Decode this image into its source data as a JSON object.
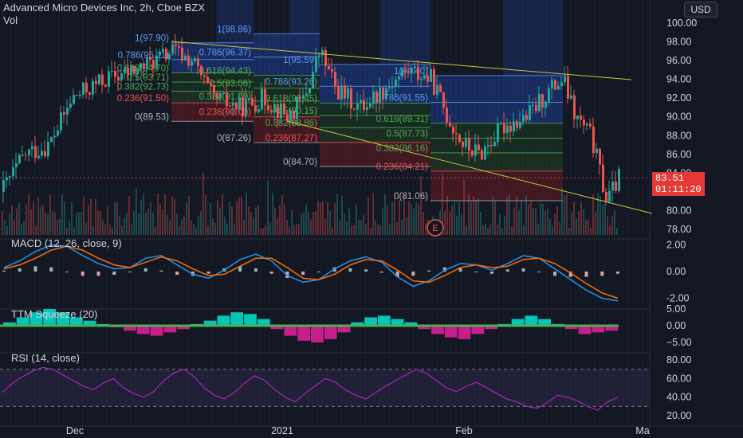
{
  "header": {
    "title": "Advanced Micro Devices Inc, 2h, Cboe BZX",
    "volume_label": "Vol",
    "currency_button": "USD"
  },
  "price_tags": {
    "last_price": "83.51",
    "countdown": "01:11:20"
  },
  "indicators": {
    "macd_label": "MACD (12, 26, close, 9)",
    "ttm_label": "TTM Squeeze (20)",
    "rsi_label": "RSI (14, close)"
  },
  "colors": {
    "background": "#131722",
    "up": "#26a69a",
    "down": "#ef5350",
    "macd_line": "#2196f3",
    "signal_line": "#ff6d00",
    "rsi_line": "#9c27b0",
    "ttm_up": "#00e5d4",
    "ttm_down": "#e91e9c",
    "trendline": "#c8c83c",
    "fib_blue": "#5b9cf6",
    "fib_green": "#4caf50",
    "fib_red": "#ef5350"
  },
  "chart_data": [
    {
      "panel": "price",
      "type": "candlestick",
      "title": "Advanced Micro Devices Inc, 2h, Cboe BZX",
      "y_axis": {
        "ticks": [
          78.0,
          80.0,
          82.0,
          84.0,
          86.0,
          88.0,
          90.0,
          92.0,
          94.0,
          96.0,
          98.0,
          100.0
        ],
        "range": [
          77.0,
          102.0
        ]
      },
      "x_axis": {
        "ticks": [
          "Dec",
          "2021",
          "Feb",
          "Ma"
        ]
      },
      "last_price": 83.51,
      "fib_retracements": [
        {
          "levels": [
            {
              "label": "1(97.90)",
              "value": 97.9
            },
            {
              "label": "0.786(96.11)",
              "value": 96.11
            },
            {
              "label": "0.618(94.70)",
              "value": 94.7
            },
            {
              "label": "0.5(93.71)",
              "value": 93.71
            },
            {
              "label": "0.382(92.73)",
              "value": 92.73
            },
            {
              "label": "0.236(91.50)",
              "value": 91.5
            },
            {
              "label": "0(89.53)",
              "value": 89.53
            }
          ]
        },
        {
          "levels": [
            {
              "label": "1(98.86)",
              "value": 98.86
            },
            {
              "label": "0.786(96.37)",
              "value": 96.37
            },
            {
              "label": "0.618(94.43)",
              "value": 94.43
            },
            {
              "label": "0.5(93.06)",
              "value": 93.06
            },
            {
              "label": "0.382(91.69)",
              "value": 91.69
            },
            {
              "label": "0.236(90.00)",
              "value": 90.0
            },
            {
              "label": "0(87.26)",
              "value": 87.26
            }
          ]
        },
        {
          "levels": [
            {
              "label": "1(95.59)",
              "value": 95.59
            },
            {
              "label": "0.786(93.26)",
              "value": 93.26
            },
            {
              "label": "0.618(91.45)",
              "value": 91.45
            },
            {
              "label": "0.5(90.15)",
              "value": 90.15
            },
            {
              "label": "0.382(88.86)",
              "value": 88.86
            },
            {
              "label": "0.236(87.27)",
              "value": 87.27
            },
            {
              "label": "0(84.70)",
              "value": 84.7
            }
          ]
        },
        {
          "levels": [
            {
              "label": "1(94.40)",
              "value": 94.4
            },
            {
              "label": "0.786(91.55)",
              "value": 91.55
            },
            {
              "label": "0.618(89.31)",
              "value": 89.31
            },
            {
              "label": "0.5(87.73)",
              "value": 87.73
            },
            {
              "label": "0.382(86.16)",
              "value": 86.16
            },
            {
              "label": "0.236(84.21)",
              "value": 84.21
            },
            {
              "label": "0(81.06)",
              "value": 81.06
            }
          ]
        }
      ],
      "earnings_marker": "E"
    },
    {
      "panel": "macd",
      "type": "line",
      "title": "MACD (12, 26, close, 9)",
      "y_axis": {
        "ticks": [
          -2.0,
          0.0,
          2.0
        ]
      },
      "series": [
        {
          "name": "MACD",
          "values": [
            0.3,
            0.8,
            1.5,
            2.0,
            1.9,
            1.2,
            0.6,
            0.2,
            0.3,
            1.0,
            1.2,
            0.5,
            -0.2,
            -0.5,
            0.1,
            0.9,
            1.3,
            0.8,
            -0.3,
            -0.8,
            -0.6,
            0.2,
            0.8,
            1.1,
            0.7,
            -0.4,
            -1.1,
            -0.7,
            0.1,
            0.6,
            0.5,
            0.1,
            0.6,
            1.2,
            1.0,
            0.2,
            -0.6,
            -1.4,
            -2.0,
            -2.2
          ]
        },
        {
          "name": "Signal",
          "values": [
            0.2,
            0.5,
            1.0,
            1.6,
            1.9,
            1.6,
            1.0,
            0.5,
            0.3,
            0.7,
            1.1,
            0.8,
            0.2,
            -0.3,
            -0.2,
            0.4,
            1.0,
            1.0,
            0.3,
            -0.5,
            -0.6,
            -0.2,
            0.5,
            0.9,
            0.8,
            0.1,
            -0.7,
            -0.8,
            -0.3,
            0.3,
            0.5,
            0.3,
            0.4,
            0.9,
            1.0,
            0.6,
            -0.1,
            -0.9,
            -1.6,
            -2.0
          ]
        }
      ]
    },
    {
      "panel": "ttm_squeeze",
      "type": "bar",
      "title": "TTM Squeeze (20)",
      "y_axis": {
        "ticks": [
          -5.0,
          0.0,
          5.0
        ]
      },
      "values": [
        1.0,
        2.5,
        4.0,
        5.0,
        4.0,
        2.5,
        1.5,
        0.5,
        -0.5,
        -1.5,
        -2.5,
        -3.0,
        -2.0,
        -1.0,
        0.5,
        1.5,
        3.0,
        4.0,
        3.5,
        2.0,
        -1.0,
        -3.0,
        -4.5,
        -5.0,
        -4.0,
        -2.0,
        1.0,
        2.5,
        3.0,
        2.0,
        1.0,
        -1.0,
        -2.5,
        -3.5,
        -4.0,
        -2.5,
        -1.0,
        0.5,
        2.0,
        3.0,
        2.0,
        0.5,
        -1.0,
        -2.5,
        -2.0,
        -1.5
      ]
    },
    {
      "panel": "rsi",
      "type": "line",
      "title": "RSI (14, close)",
      "y_axis": {
        "ticks": [
          20.0,
          40.0,
          60.0,
          80.0
        ]
      },
      "values": [
        45,
        55,
        62,
        68,
        72,
        70,
        64,
        58,
        52,
        48,
        55,
        60,
        50,
        44,
        40,
        46,
        58,
        66,
        70,
        62,
        50,
        42,
        38,
        45,
        55,
        63,
        58,
        48,
        40,
        35,
        44,
        52,
        60,
        56,
        48,
        42,
        38,
        45,
        52,
        58,
        64,
        70,
        66,
        58,
        50,
        46,
        52,
        56,
        50,
        44,
        38,
        35,
        30,
        28,
        34,
        42,
        40,
        36,
        30,
        26,
        35,
        40
      ]
    }
  ]
}
